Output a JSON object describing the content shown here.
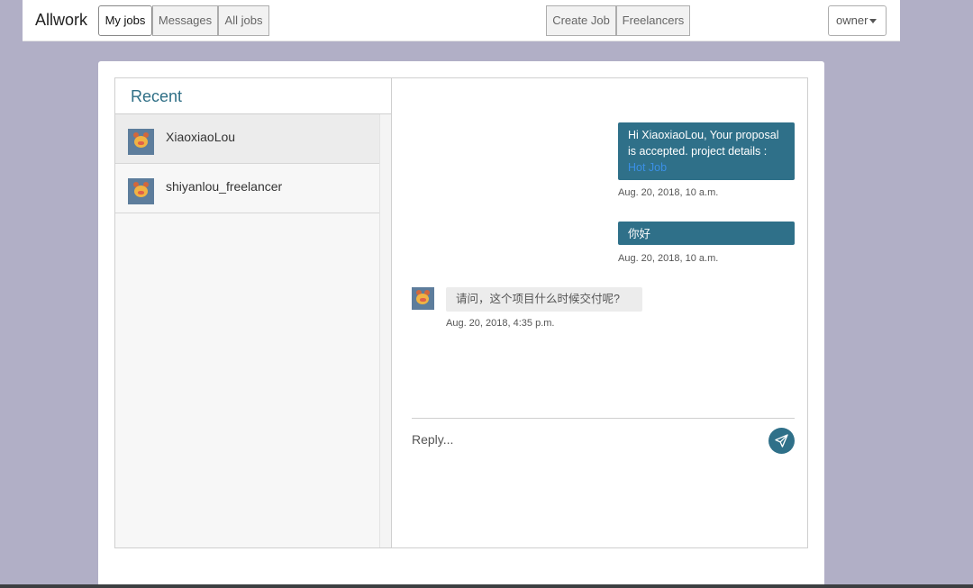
{
  "navbar": {
    "brand": "Allwork",
    "tabs": [
      "My jobs",
      "Messages",
      "All jobs"
    ],
    "actions": [
      "Create Job",
      "Freelancers"
    ],
    "user_menu": "owner"
  },
  "sidebar": {
    "title": "Recent",
    "contacts": [
      {
        "name": "XiaoxiaoLou",
        "selected": true
      },
      {
        "name": "shiyanlou_freelancer",
        "selected": false
      }
    ]
  },
  "chat": {
    "messages": [
      {
        "direction": "out",
        "text": "Hi XiaoxiaoLou, Your proposal is accepted. project details :",
        "link": "Hot Job",
        "timestamp": "Aug. 20, 2018, 10 a.m."
      },
      {
        "direction": "out",
        "text": "你好",
        "timestamp": "Aug. 20, 2018, 10 a.m."
      },
      {
        "direction": "in",
        "text": "请问，这个项目什么时候交付呢?",
        "timestamp": "Aug. 20, 2018, 4:35 p.m."
      }
    ],
    "reply_placeholder": "Reply..."
  },
  "colors": {
    "accent": "#2f7089",
    "background": "#b1afc6",
    "link": "#3b8fe6"
  },
  "icons": {
    "send": "send-icon",
    "dropdown": "caret-down-icon",
    "avatar": "avatar-icon"
  }
}
